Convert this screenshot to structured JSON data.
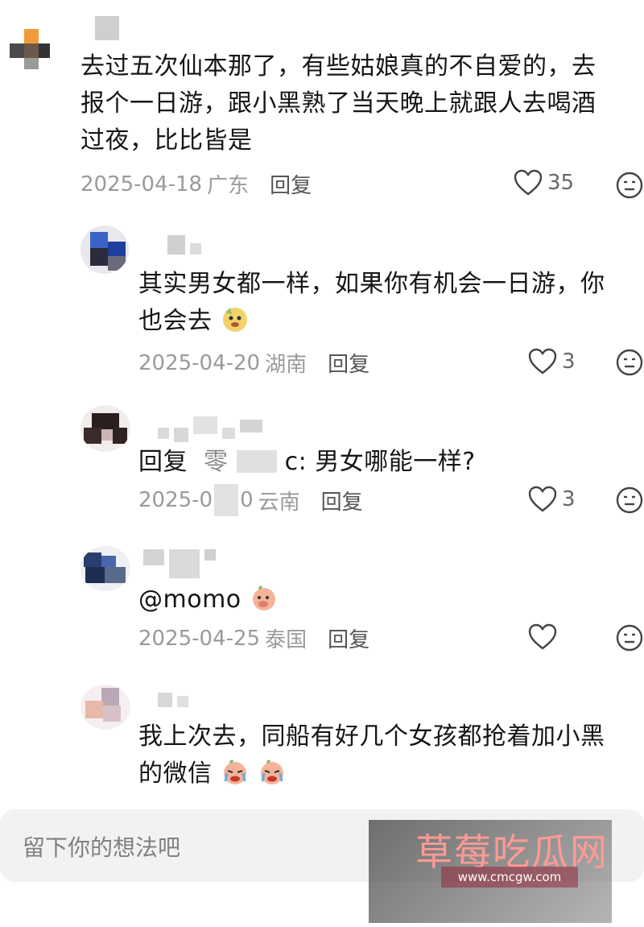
{
  "comments": [
    {
      "text_lines": [
        "去过五次仙本那了，有些姑娘真的不自爱的，去",
        "报个一日游，跟小黑熟了当天晚上就跟人去喝酒",
        "过夜，比比皆是"
      ],
      "date": "2025-04-18",
      "location": "广东",
      "reply_label": "回复",
      "likes": "35"
    },
    {
      "text_lines": [
        "其实男女都一样，如果你有机会一日游，你",
        "也会去"
      ],
      "date": "2025-04-20",
      "location": "湖南",
      "reply_label": "回复",
      "likes": "3"
    },
    {
      "reply_prefix": "回复",
      "reply_target": "零",
      "reply_text": "c: 男女哪能一样?",
      "date": "2025-0",
      "date_tail": "0",
      "location": "云南",
      "reply_label": "回复",
      "likes": "3"
    },
    {
      "mention": "@momo",
      "date": "2025-04-25",
      "location": "泰国",
      "reply_label": "回复",
      "likes": ""
    },
    {
      "text_lines": [
        "我上次去，同船有好几个女孩都抢着加小黑",
        "的微信"
      ]
    }
  ],
  "input": {
    "placeholder": "留下你的想法吧"
  },
  "watermark": {
    "title": "草莓吃瓜网",
    "url": "www.cmcgw.com"
  },
  "icons": {
    "like": "heart-outline-icon",
    "dislike": "meh-face-icon"
  },
  "colors": {
    "meta": "#9a9a9a",
    "text": "#161616",
    "accent_watermark": "#ff9a94"
  }
}
